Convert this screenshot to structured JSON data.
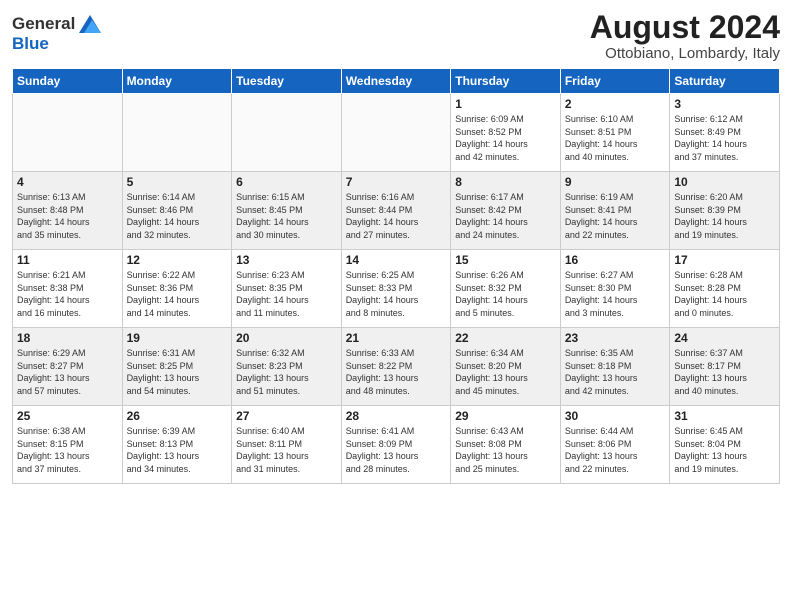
{
  "header": {
    "logo_general": "General",
    "logo_blue": "Blue",
    "month_title": "August 2024",
    "location": "Ottobiano, Lombardy, Italy"
  },
  "days_of_week": [
    "Sunday",
    "Monday",
    "Tuesday",
    "Wednesday",
    "Thursday",
    "Friday",
    "Saturday"
  ],
  "weeks": [
    [
      {
        "day": "",
        "info": ""
      },
      {
        "day": "",
        "info": ""
      },
      {
        "day": "",
        "info": ""
      },
      {
        "day": "",
        "info": ""
      },
      {
        "day": "1",
        "info": "Sunrise: 6:09 AM\nSunset: 8:52 PM\nDaylight: 14 hours\nand 42 minutes."
      },
      {
        "day": "2",
        "info": "Sunrise: 6:10 AM\nSunset: 8:51 PM\nDaylight: 14 hours\nand 40 minutes."
      },
      {
        "day": "3",
        "info": "Sunrise: 6:12 AM\nSunset: 8:49 PM\nDaylight: 14 hours\nand 37 minutes."
      }
    ],
    [
      {
        "day": "4",
        "info": "Sunrise: 6:13 AM\nSunset: 8:48 PM\nDaylight: 14 hours\nand 35 minutes."
      },
      {
        "day": "5",
        "info": "Sunrise: 6:14 AM\nSunset: 8:46 PM\nDaylight: 14 hours\nand 32 minutes."
      },
      {
        "day": "6",
        "info": "Sunrise: 6:15 AM\nSunset: 8:45 PM\nDaylight: 14 hours\nand 30 minutes."
      },
      {
        "day": "7",
        "info": "Sunrise: 6:16 AM\nSunset: 8:44 PM\nDaylight: 14 hours\nand 27 minutes."
      },
      {
        "day": "8",
        "info": "Sunrise: 6:17 AM\nSunset: 8:42 PM\nDaylight: 14 hours\nand 24 minutes."
      },
      {
        "day": "9",
        "info": "Sunrise: 6:19 AM\nSunset: 8:41 PM\nDaylight: 14 hours\nand 22 minutes."
      },
      {
        "day": "10",
        "info": "Sunrise: 6:20 AM\nSunset: 8:39 PM\nDaylight: 14 hours\nand 19 minutes."
      }
    ],
    [
      {
        "day": "11",
        "info": "Sunrise: 6:21 AM\nSunset: 8:38 PM\nDaylight: 14 hours\nand 16 minutes."
      },
      {
        "day": "12",
        "info": "Sunrise: 6:22 AM\nSunset: 8:36 PM\nDaylight: 14 hours\nand 14 minutes."
      },
      {
        "day": "13",
        "info": "Sunrise: 6:23 AM\nSunset: 8:35 PM\nDaylight: 14 hours\nand 11 minutes."
      },
      {
        "day": "14",
        "info": "Sunrise: 6:25 AM\nSunset: 8:33 PM\nDaylight: 14 hours\nand 8 minutes."
      },
      {
        "day": "15",
        "info": "Sunrise: 6:26 AM\nSunset: 8:32 PM\nDaylight: 14 hours\nand 5 minutes."
      },
      {
        "day": "16",
        "info": "Sunrise: 6:27 AM\nSunset: 8:30 PM\nDaylight: 14 hours\nand 3 minutes."
      },
      {
        "day": "17",
        "info": "Sunrise: 6:28 AM\nSunset: 8:28 PM\nDaylight: 14 hours\nand 0 minutes."
      }
    ],
    [
      {
        "day": "18",
        "info": "Sunrise: 6:29 AM\nSunset: 8:27 PM\nDaylight: 13 hours\nand 57 minutes."
      },
      {
        "day": "19",
        "info": "Sunrise: 6:31 AM\nSunset: 8:25 PM\nDaylight: 13 hours\nand 54 minutes."
      },
      {
        "day": "20",
        "info": "Sunrise: 6:32 AM\nSunset: 8:23 PM\nDaylight: 13 hours\nand 51 minutes."
      },
      {
        "day": "21",
        "info": "Sunrise: 6:33 AM\nSunset: 8:22 PM\nDaylight: 13 hours\nand 48 minutes."
      },
      {
        "day": "22",
        "info": "Sunrise: 6:34 AM\nSunset: 8:20 PM\nDaylight: 13 hours\nand 45 minutes."
      },
      {
        "day": "23",
        "info": "Sunrise: 6:35 AM\nSunset: 8:18 PM\nDaylight: 13 hours\nand 42 minutes."
      },
      {
        "day": "24",
        "info": "Sunrise: 6:37 AM\nSunset: 8:17 PM\nDaylight: 13 hours\nand 40 minutes."
      }
    ],
    [
      {
        "day": "25",
        "info": "Sunrise: 6:38 AM\nSunset: 8:15 PM\nDaylight: 13 hours\nand 37 minutes."
      },
      {
        "day": "26",
        "info": "Sunrise: 6:39 AM\nSunset: 8:13 PM\nDaylight: 13 hours\nand 34 minutes."
      },
      {
        "day": "27",
        "info": "Sunrise: 6:40 AM\nSunset: 8:11 PM\nDaylight: 13 hours\nand 31 minutes."
      },
      {
        "day": "28",
        "info": "Sunrise: 6:41 AM\nSunset: 8:09 PM\nDaylight: 13 hours\nand 28 minutes."
      },
      {
        "day": "29",
        "info": "Sunrise: 6:43 AM\nSunset: 8:08 PM\nDaylight: 13 hours\nand 25 minutes."
      },
      {
        "day": "30",
        "info": "Sunrise: 6:44 AM\nSunset: 8:06 PM\nDaylight: 13 hours\nand 22 minutes."
      },
      {
        "day": "31",
        "info": "Sunrise: 6:45 AM\nSunset: 8:04 PM\nDaylight: 13 hours\nand 19 minutes."
      }
    ]
  ]
}
